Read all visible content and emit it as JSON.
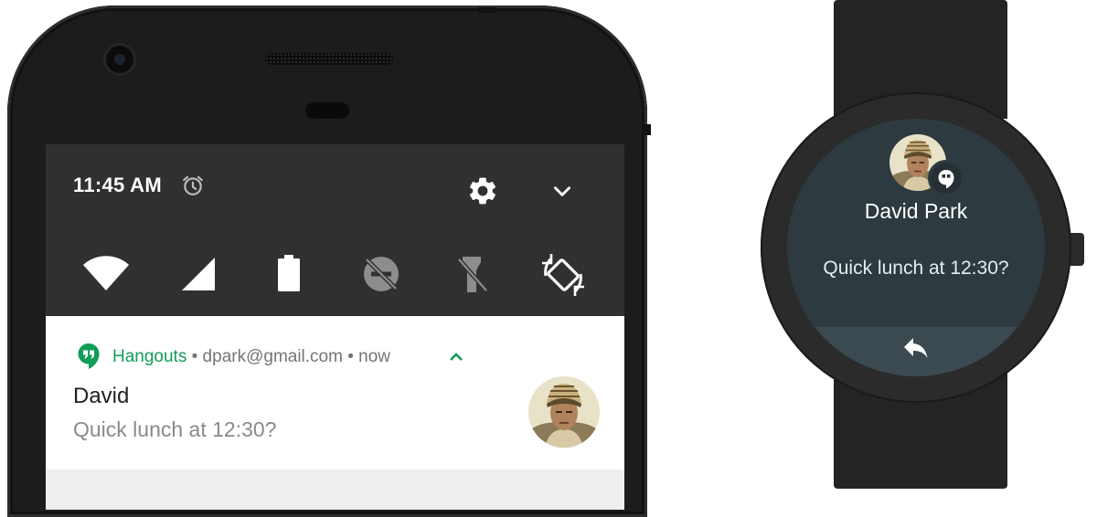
{
  "phone": {
    "status_bar": {
      "time": "11:45 AM",
      "icons": [
        "alarm-icon",
        "settings-icon",
        "expand-icon"
      ]
    },
    "quick_settings": [
      {
        "icon": "wifi-icon",
        "state": "on"
      },
      {
        "icon": "cell-signal-icon",
        "state": "on"
      },
      {
        "icon": "battery-icon",
        "state": "full"
      },
      {
        "icon": "do-not-disturb-icon",
        "state": "off"
      },
      {
        "icon": "flashlight-icon",
        "state": "off"
      },
      {
        "icon": "auto-rotate-icon",
        "state": "on"
      }
    ],
    "notification": {
      "app_name": "Hangouts",
      "account": "• dpark@gmail.com • now",
      "title": "David",
      "text": "Quick lunch at 12:30?"
    }
  },
  "watch": {
    "notification": {
      "title": "David Park",
      "text": "Quick lunch at 12:30?",
      "action_icon": "reply-icon"
    }
  },
  "colors": {
    "hangouts_green": "#0f9d58",
    "shade_dark": "#303030",
    "watch_face": "#2d3b40"
  }
}
